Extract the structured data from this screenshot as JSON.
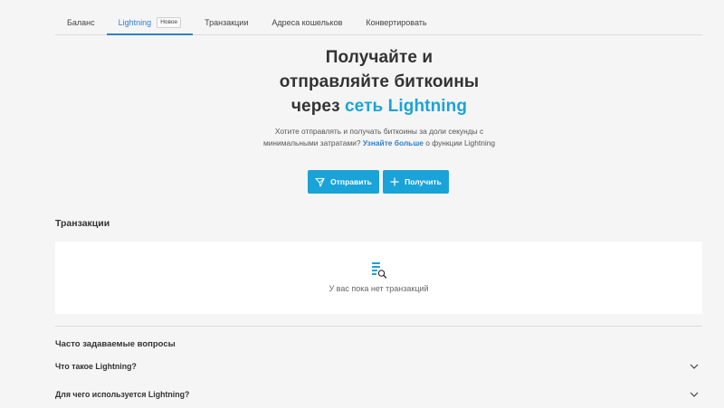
{
  "tabs": [
    {
      "label": "Баланс"
    },
    {
      "label": "Lightning",
      "badge": "Новое"
    },
    {
      "label": "Транзакции"
    },
    {
      "label": "Адреса кошельков"
    },
    {
      "label": "Конвертировать"
    }
  ],
  "hero": {
    "title_line1": "Получайте и",
    "title_line2": "отправляйте биткоины",
    "title_line3_prefix": "через ",
    "title_line3_accent": "сеть Lightning",
    "desc_before": "Хотите отправлять и получать биткоины за доли секунды с минимальными затратами? ",
    "desc_link": "Узнайте больше",
    "desc_after": " о функции Lightning"
  },
  "actions": {
    "send_label": "Отправить",
    "receive_label": "Получить"
  },
  "transactions": {
    "title": "Транзакции",
    "empty_text": "У вас пока нет транзакций"
  },
  "faq": {
    "title": "Часто задаваемые вопросы",
    "items": [
      {
        "question": "Что такое Lightning?"
      },
      {
        "question": "Для чего используется Lightning?"
      }
    ]
  },
  "colors": {
    "accent": "#1aa3d8",
    "link": "#2d7fd1",
    "background": "#f5f5f5"
  }
}
